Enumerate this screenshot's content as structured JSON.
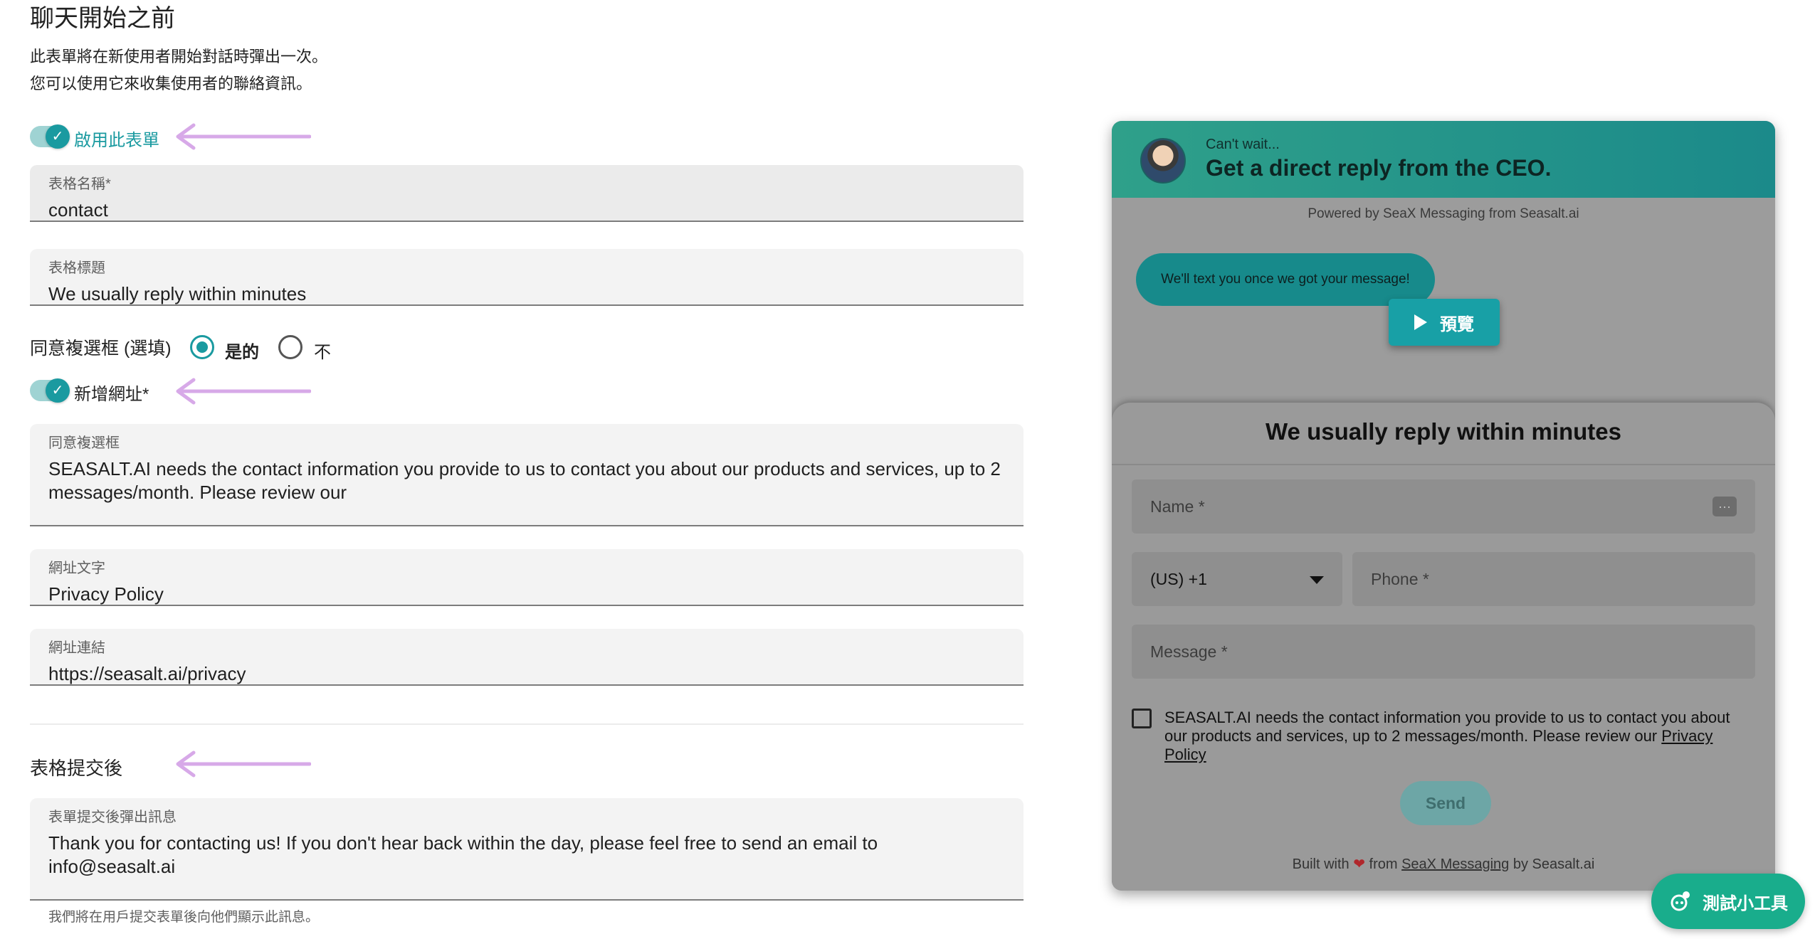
{
  "form": {
    "section_title": "聊天開始之前",
    "desc_line1": "此表單將在新使用者開始對話時彈出一次。",
    "desc_line2": "您可以使用它來收集使用者的聯絡資訊。",
    "enable_toggle_label": "啟用此表單",
    "enable_toggle_on": true,
    "form_name": {
      "label": "表格名稱*",
      "value": "contact"
    },
    "form_title": {
      "label": "表格標題",
      "value": "We usually reply within minutes"
    },
    "consent_checkbox": {
      "label": "同意複選框 (選填)",
      "option_yes": "是的",
      "option_no": "不",
      "selected": "是的"
    },
    "add_url_toggle_label": "新增網址*",
    "add_url_toggle_on": true,
    "consent_text": {
      "label": "同意複選框",
      "value": "SEASALT.AI needs the contact information you provide to us to contact you about our products and services, up to 2 messages/month. Please review our"
    },
    "url_text": {
      "label": "網址文字",
      "value": "Privacy Policy"
    },
    "url_link": {
      "label": "網址連結",
      "value": "https://seasalt.ai/privacy"
    },
    "after_submit_title": "表格提交後",
    "after_submit_message": {
      "label": "表單提交後彈出訊息",
      "value": "Thank you for contacting us! If you don't hear back within the day, please feel free to send an email to info@seasalt.ai"
    },
    "after_submit_hint": "我們將在用戶提交表單後向他們顯示此訊息。"
  },
  "preview": {
    "header_small": "Can't wait...",
    "header_big": "Get a direct reply from the CEO.",
    "powered_by": "Powered by SeaX Messaging from Seasalt.ai",
    "bubble": "We'll text you once we got your message!",
    "preview_button": "預覽",
    "card_title": "We usually reply within minutes",
    "name_placeholder": "Name *",
    "country_code": "(US) +1",
    "phone_placeholder": "Phone *",
    "message_placeholder": "Message *",
    "consent": "SEASALT.AI needs the contact information you provide to us to contact you about our products and services, up to 2 messages/month. Please review our",
    "consent_link": "Privacy Policy",
    "send_button": "Send",
    "built_prefix": "Built with",
    "built_from": "from",
    "built_link": "SeaX Messaging",
    "built_suffix": "by Seasalt.ai"
  },
  "test_widget_button": "測試小工具",
  "colors": {
    "accent": "#1a9aa0",
    "arrow": "#d7a9e8",
    "header": "#2fa08a",
    "fab": "#19ad8c"
  },
  "icons": [
    "check-icon",
    "arrow-left-icon",
    "play-icon",
    "dots-icon",
    "chevron-down-icon",
    "heart-icon",
    "widget-icon"
  ]
}
